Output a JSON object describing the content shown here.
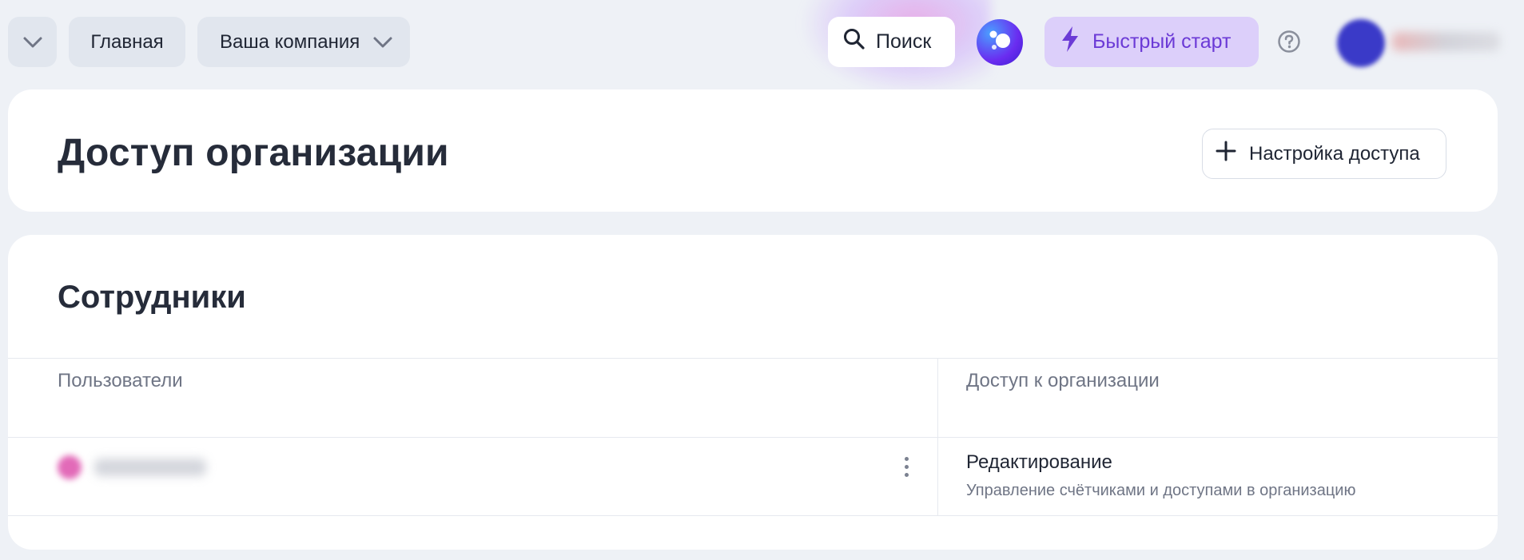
{
  "header": {
    "home_label": "Главная",
    "company_label": "Ваша компания",
    "search_label": "Поиск",
    "quick_start_label": "Быстрый старт"
  },
  "page": {
    "title": "Доступ организации",
    "access_settings_label": "Настройка доступа"
  },
  "staff": {
    "title": "Сотрудники",
    "columns": {
      "users": "Пользователи",
      "access": "Доступ к организации"
    },
    "rows": [
      {
        "role": "Редактирование",
        "description": "Управление счётчиками и доступами в организацию"
      }
    ]
  },
  "icons": {
    "collapse": "chevron-down-icon",
    "company_dropdown": "chevron-down-icon",
    "search": "search-icon",
    "assistant": "alice-icon",
    "quick_start": "lightning-icon",
    "help": "help-icon",
    "add": "plus-icon",
    "more": "more-vertical-icon"
  },
  "colors": {
    "background": "#eef1f6",
    "accent_purple": "#6b3ad6",
    "quick_start_bg": "#dccffa",
    "pill_bg": "#e1e6ee"
  }
}
